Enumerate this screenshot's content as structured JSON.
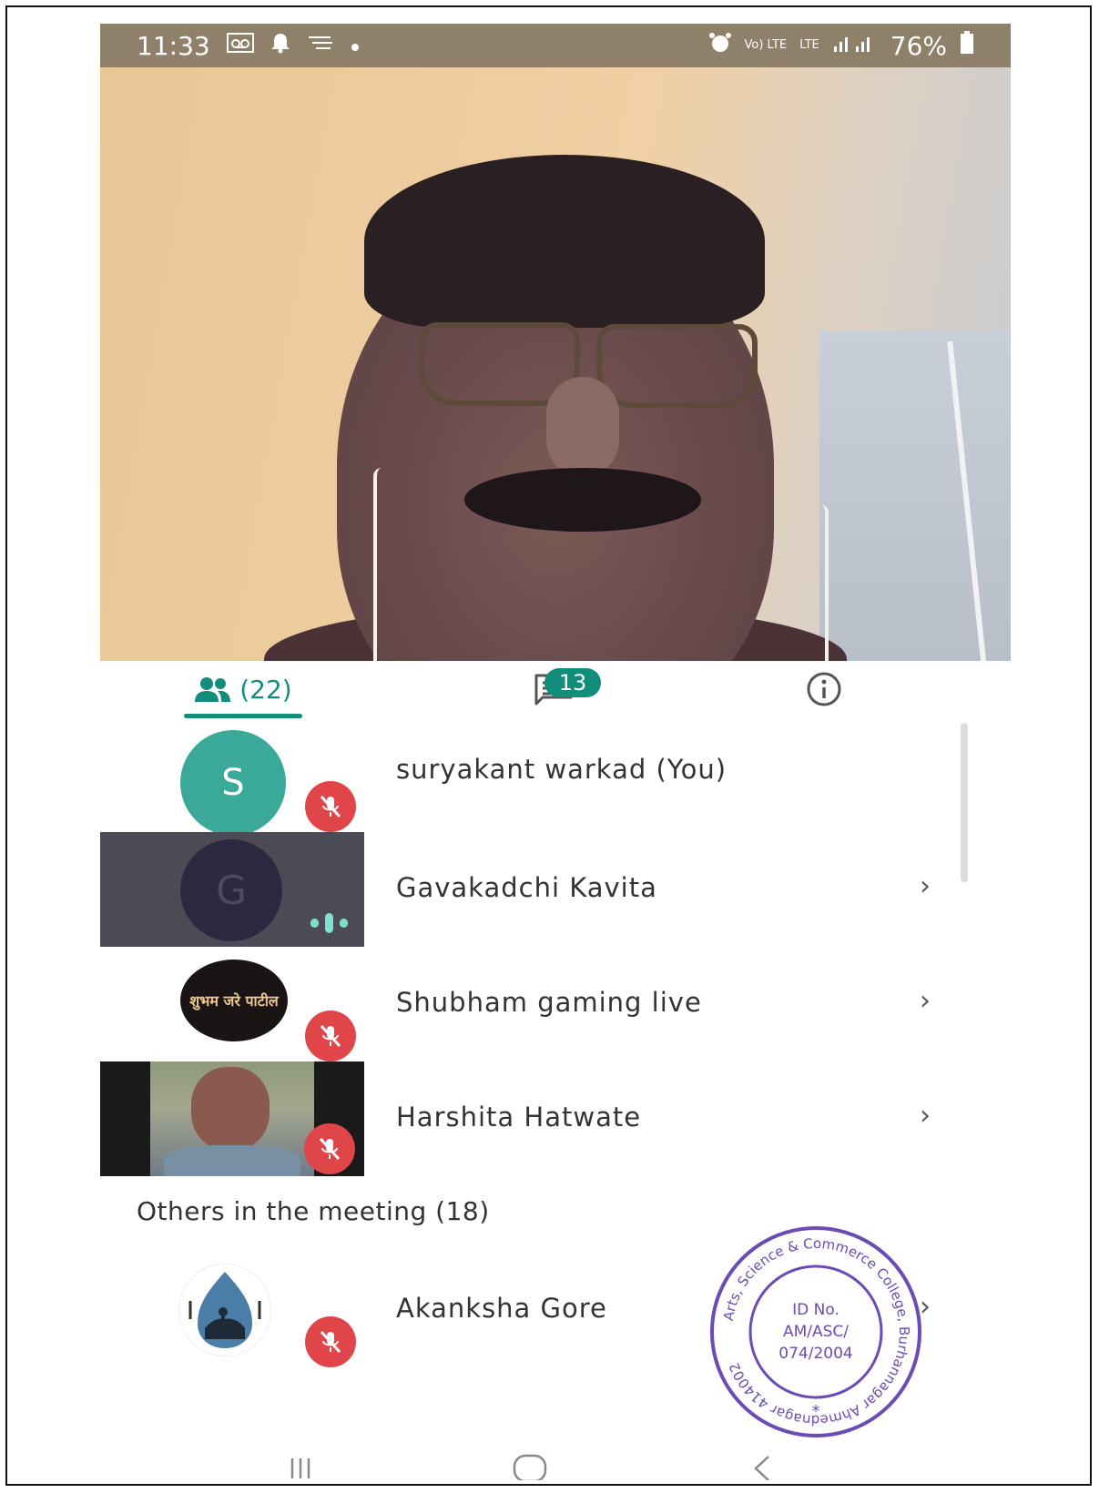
{
  "status_bar": {
    "time": "11:33",
    "battery": "76%",
    "lte_top": "Vo) LTE",
    "lte_bottom": "LTE"
  },
  "tabs": {
    "people_count": "(22)",
    "chat_badge": "13"
  },
  "participants": [
    {
      "name": "suryakant warkad (You)",
      "initial": "S",
      "avatar_color": "#3aa99a",
      "muted": true
    },
    {
      "name": "Gavakadchi Kavita",
      "initial": "G",
      "avatar_color": "#2c2840",
      "speaking": true
    },
    {
      "name": "Shubham gaming live",
      "avatar_text": "शुभम जरे पाटील",
      "muted": true
    },
    {
      "name": "Harshita Hatwate",
      "muted": true
    }
  ],
  "others_section": {
    "title": "Others in the meeting (18)",
    "participants": [
      {
        "name": "Akanksha Gore",
        "muted": true
      }
    ]
  },
  "stamp": {
    "ring_text": "Arts, Science & Commerce College, Burhannagar Ahmednagar 414002",
    "line1": "ID No.",
    "line2": "AM/ASC/",
    "line3": "074/2004"
  },
  "colors": {
    "accent": "#128d7c",
    "mute_red": "#e0454a",
    "status_bar": "#8f806a"
  }
}
